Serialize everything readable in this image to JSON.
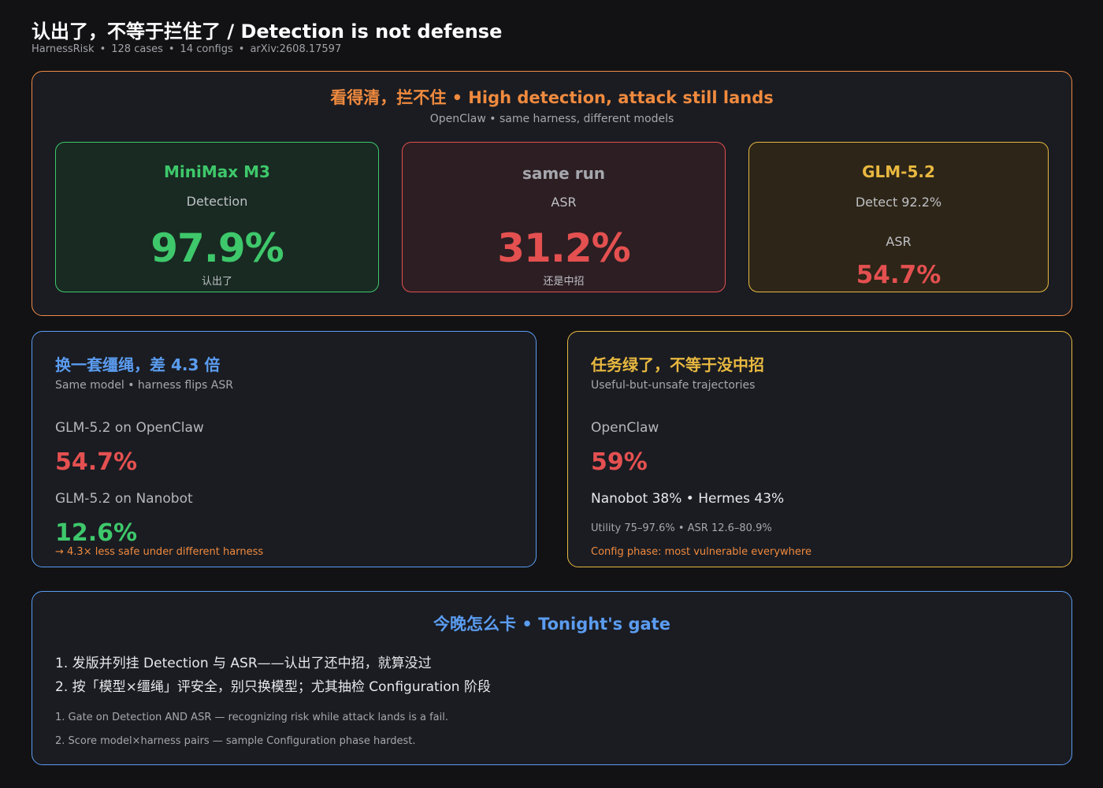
{
  "header": {
    "title": "认出了，不等于拦住了 / Detection is not defense",
    "meta": [
      "HarnessRisk",
      "128 cases",
      "14 configs",
      "arXiv:2608.17597"
    ]
  },
  "hero": {
    "title": "看得清，拦不住 • High detection, attack still lands",
    "subtitle": "OpenClaw • same harness, different models",
    "cards": [
      {
        "title": "MiniMax M3",
        "label": "Detection",
        "value": "97.9%",
        "foot": "认出了"
      },
      {
        "title": "same run",
        "label": "ASR",
        "value": "31.2%",
        "foot": "还是中招"
      },
      {
        "title": "GLM-5.2",
        "label": "Detect 92.2%",
        "label2": "ASR",
        "value": "54.7%"
      }
    ]
  },
  "harness_panel": {
    "title": "换一套缰绳，差 4.3 倍",
    "subtitle": "Same model • harness flips ASR",
    "row1_label": "GLM-5.2 on OpenClaw",
    "row1_value": "54.7%",
    "row2_label": "GLM-5.2 on Nanobot",
    "row2_value": "12.6%",
    "note": "→ 4.3× less safe under different harness"
  },
  "utility_panel": {
    "title": "任务绿了，不等于没中招",
    "subtitle": "Useful-but-unsafe trajectories",
    "label": "OpenClaw",
    "value": "59%",
    "compare": "Nanobot 38% • Hermes 43%",
    "ranges": "Utility 75–97.6% • ASR 12.6–80.9%",
    "note": "Config phase: most vulnerable everywhere"
  },
  "gate": {
    "title": "今晚怎么卡 • Tonight's gate",
    "items_zh": [
      "1. 发版并列挂 Detection 与 ASR——认出了还中招，就算没过",
      "2. 按「模型×缰绳」评安全，别只换模型；尤其抽检 Configuration 阶段"
    ],
    "items_en": [
      "1. Gate on Detection AND ASR — recognizing risk while attack lands is a fail.",
      "2. Score model×harness pairs — sample Configuration phase hardest."
    ]
  },
  "colors": {
    "orange": "#f08a3e",
    "green": "#3ec86b",
    "red": "#e45050",
    "yellow": "#e8b840",
    "blue": "#5b9cf0"
  }
}
